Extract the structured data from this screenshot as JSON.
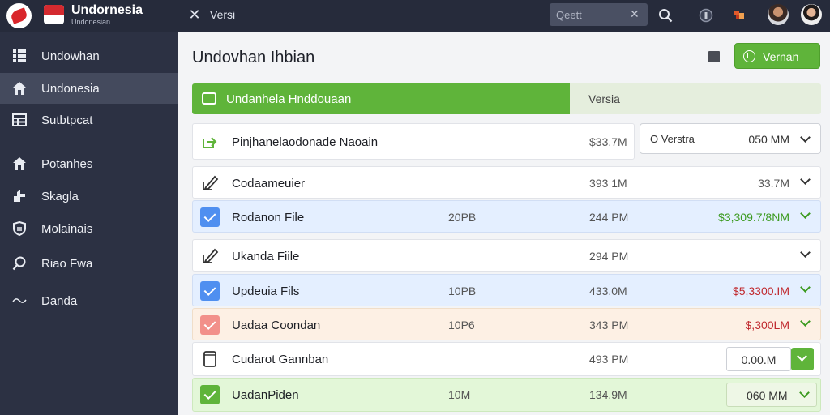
{
  "brand": {
    "title": "Undornesia",
    "subtitle": "Undonesian"
  },
  "topbar": {
    "title": "Versi",
    "search_placeholder": "Qeett"
  },
  "sidebar": {
    "items": [
      {
        "label": "Undowhan",
        "icon": "grid-icon"
      },
      {
        "label": "Undonesia",
        "icon": "home-icon",
        "active": true
      },
      {
        "label": "Sutbtpcat",
        "icon": "table-icon"
      },
      {
        "label": "Potanhes",
        "icon": "home-icon"
      },
      {
        "label": "Skagla",
        "icon": "share-icon"
      },
      {
        "label": "Molainais",
        "icon": "shield-icon"
      },
      {
        "label": "Riao Fwa",
        "icon": "search-icon"
      },
      {
        "label": "Danda",
        "icon": "wave-icon"
      }
    ]
  },
  "main": {
    "title": "Undovhan Ihbian",
    "primary_button": "Vernan",
    "banner": {
      "label": "Undanhela Hnddouaan",
      "right": "Versia",
      "progress": 0.6
    },
    "first_row": {
      "name": "Pinjhanelaodonade Naoain",
      "time": "$33.7M"
    },
    "select": {
      "label": "O Verstra",
      "value": "050 MM"
    },
    "rows": [
      {
        "name": "Codaameuier",
        "size": "",
        "time": "393 1M",
        "value": "33.7M"
      },
      {
        "name": "Rodanon File",
        "size": "20PB",
        "time": "244 PM",
        "value": "$3,309.7/8NM"
      },
      {
        "name": "Ukanda Fiile",
        "size": "",
        "time": "294 PM",
        "value": ""
      },
      {
        "name": "Updeuia Fils",
        "size": "10PB",
        "time": "433.0M",
        "value": "$5,3300.IM"
      },
      {
        "name": "Uadaa Coondan",
        "size": "10P6",
        "time": "343 PM",
        "value": "$,300LM"
      },
      {
        "name": "Cudarot Gannban",
        "size": "",
        "time": "493 PM",
        "value": "0.00.M"
      },
      {
        "name": "UadanPiden",
        "size": "10M",
        "time": "134.9M",
        "value": "060 MM"
      }
    ]
  },
  "colors": {
    "accent": "#5fb43a",
    "sidebar": "#2c3143",
    "topbar": "#262b3b",
    "blue": "#4f8ff0",
    "red": "#c0282d"
  }
}
